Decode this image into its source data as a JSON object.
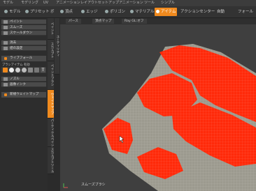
{
  "menubar": [
    "モデル",
    "モデリング",
    "UV",
    "アニメーション",
    "レイアウト",
    "セットアップ",
    "アニメーション",
    "ツール",
    "シンプル"
  ],
  "toolbar": {
    "items": [
      "モデル",
      "プリセット",
      "ボ",
      "頂点",
      "エッジ",
      "ポリゴン",
      "マテリアル",
      "アイテム",
      "アクションセンター",
      "自動",
      "フォール"
    ],
    "active": "アイテム"
  },
  "left_panel": {
    "buttons_top": [
      "ペイント",
      "スムーズ",
      "スケールダウン"
    ],
    "buttons_mid": [
      "消去",
      "値の設定"
    ],
    "toggle_label": "ライブフォール",
    "brush_label": "ブラシアイテム 有効",
    "buttons_bottom": [
      "ノズル",
      "画像インク"
    ],
    "orange_button": "新規ウェイトマップ"
  },
  "vertical_tabs": [
    "ペイント",
    "スカルプト",
    "ペイントブラシ",
    "ウェイトマップ",
    "パーティクルペイント",
    "スカルプトツール",
    "ユーティリティ"
  ],
  "vertical_tabs_active": "ウェイトマップ",
  "viewport": {
    "tabs": [
      "パース",
      "頂点マップ",
      "Ray GL:オフ"
    ],
    "brush_label": "スムーズブラシ"
  },
  "colors": {
    "accent": "#f08a1e",
    "weight_red": "#ff2a0a",
    "terrain_gray": "#9c9a8f"
  }
}
